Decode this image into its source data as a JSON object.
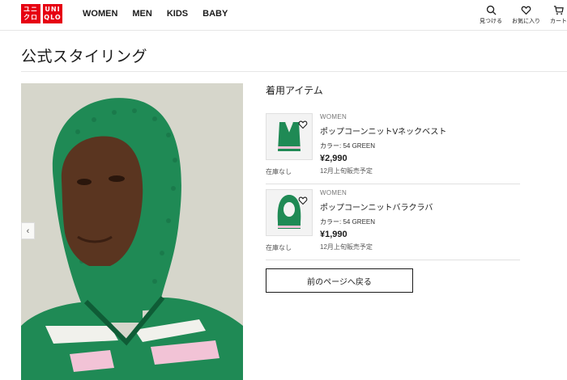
{
  "logo": {
    "top": "ユニ\nクロ",
    "bottom": "UNI\nQLO",
    "top_l1": "ユニ",
    "top_l2": "クロ",
    "bot_l1": "UNI",
    "bot_l2": "QLO"
  },
  "nav": {
    "items": [
      "WOMEN",
      "MEN",
      "KIDS",
      "BABY"
    ]
  },
  "header_actions": {
    "search": "見つける",
    "favorites": "お気に入り",
    "cart": "カート"
  },
  "page": {
    "title": "公式スタイリング"
  },
  "section": {
    "heading": "着用アイテム"
  },
  "items": [
    {
      "gender": "WOMEN",
      "name": "ポップコーンニットVネックベスト",
      "color": "カラー: 54 GREEN",
      "price": "¥2,990",
      "note": "12月上旬販売予定",
      "stock": "在庫なし"
    },
    {
      "gender": "WOMEN",
      "name": "ポップコーンニットバラクラバ",
      "color": "カラー: 54 GREEN",
      "price": "¥1,990",
      "note": "12月上旬販売予定",
      "stock": "在庫なし"
    }
  ],
  "back_button": "前のページへ戻る",
  "colors": {
    "brand": "#e60012",
    "knit_green": "#1f8a55",
    "accent_pink": "#f2c3d6"
  }
}
